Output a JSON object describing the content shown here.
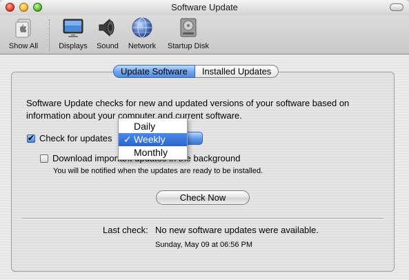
{
  "window": {
    "title": "Software Update"
  },
  "toolbar": {
    "items": [
      {
        "label": "Show All",
        "icon": "apple-icon"
      },
      {
        "label": "Displays",
        "icon": "display-icon"
      },
      {
        "label": "Sound",
        "icon": "speaker-icon"
      },
      {
        "label": "Network",
        "icon": "globe-icon"
      },
      {
        "label": "Startup Disk",
        "icon": "hard-disk-icon"
      }
    ]
  },
  "tabs": [
    {
      "label": "Update Software",
      "active": true
    },
    {
      "label": "Installed Updates",
      "active": false
    }
  ],
  "main": {
    "description": "Software Update checks for new and updated versions of your software based on information about your computer and current software.",
    "check_updates_label": "Check for updates",
    "check_updates_checked": true,
    "download_label": "Download important updates in the background",
    "download_checked": false,
    "download_note": "You will be notified when the updates are ready to be installed.",
    "check_now_label": "Check Now",
    "last_check_label": "Last check:",
    "last_check_value": "No new software updates were available.",
    "last_check_date": "Sunday, May 09 at 06:56 PM"
  },
  "frequency_menu": {
    "options": [
      "Daily",
      "Weekly",
      "Monthly"
    ],
    "selected": "Weekly",
    "check_mark": "✓"
  },
  "colors": {
    "selection_blue": "#2b64cf",
    "tab_active_blue": "#6ea4ec"
  }
}
